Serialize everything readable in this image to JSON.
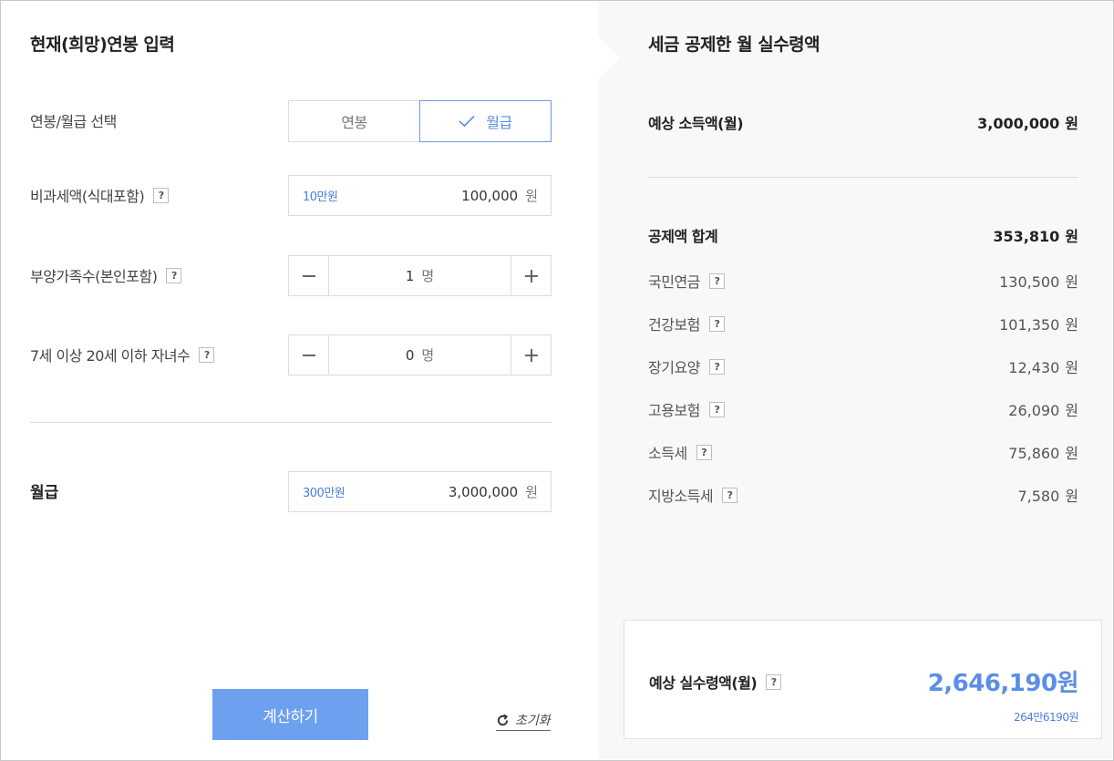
{
  "left": {
    "title": "현재(희망)연봉 입력",
    "type_label": "연봉/월급 선택",
    "type_options": [
      "연봉",
      "월급"
    ],
    "selected_type": "월급",
    "nontax": {
      "label": "비과세액(식대포함)",
      "hint": "10만원",
      "value": "100,000",
      "unit": "원"
    },
    "dependents": {
      "label": "부양가족수(본인포함)",
      "value": "1",
      "unit": "명"
    },
    "children": {
      "label": "7세 이상 20세 이하 자녀수",
      "value": "0",
      "unit": "명"
    },
    "salary": {
      "label": "월급",
      "hint": "300만원",
      "value": "3,000,000",
      "unit": "원"
    },
    "calc_button": "계산하기",
    "reset_link": "초기화",
    "help_mark": "?"
  },
  "right": {
    "title": "세금 공제한 월 실수령액",
    "expected_income": {
      "label": "예상 소득액(월)",
      "value": "3,000,000",
      "unit": "원"
    },
    "deduction_total": {
      "label": "공제액 합계",
      "value": "353,810",
      "unit": "원"
    },
    "deductions": [
      {
        "label": "국민연금",
        "value": "130,500",
        "unit": "원"
      },
      {
        "label": "건강보험",
        "value": "101,350",
        "unit": "원"
      },
      {
        "label": "장기요양",
        "value": "12,430",
        "unit": "원"
      },
      {
        "label": "고용보험",
        "value": "26,090",
        "unit": "원"
      },
      {
        "label": "소득세",
        "value": "75,860",
        "unit": "원"
      },
      {
        "label": "지방소득세",
        "value": "7,580",
        "unit": "원"
      }
    ],
    "result": {
      "label": "예상 실수령액(월)",
      "value": "2,646,190원",
      "sub": "264만6190원"
    }
  },
  "colors": {
    "accent": "#5b8ee8",
    "button": "#6ea0f0",
    "panel": "#f7f8f7"
  },
  "icons": {
    "check": "check-icon",
    "minus": "minus-icon",
    "plus": "plus-icon",
    "reset": "refresh-icon"
  }
}
